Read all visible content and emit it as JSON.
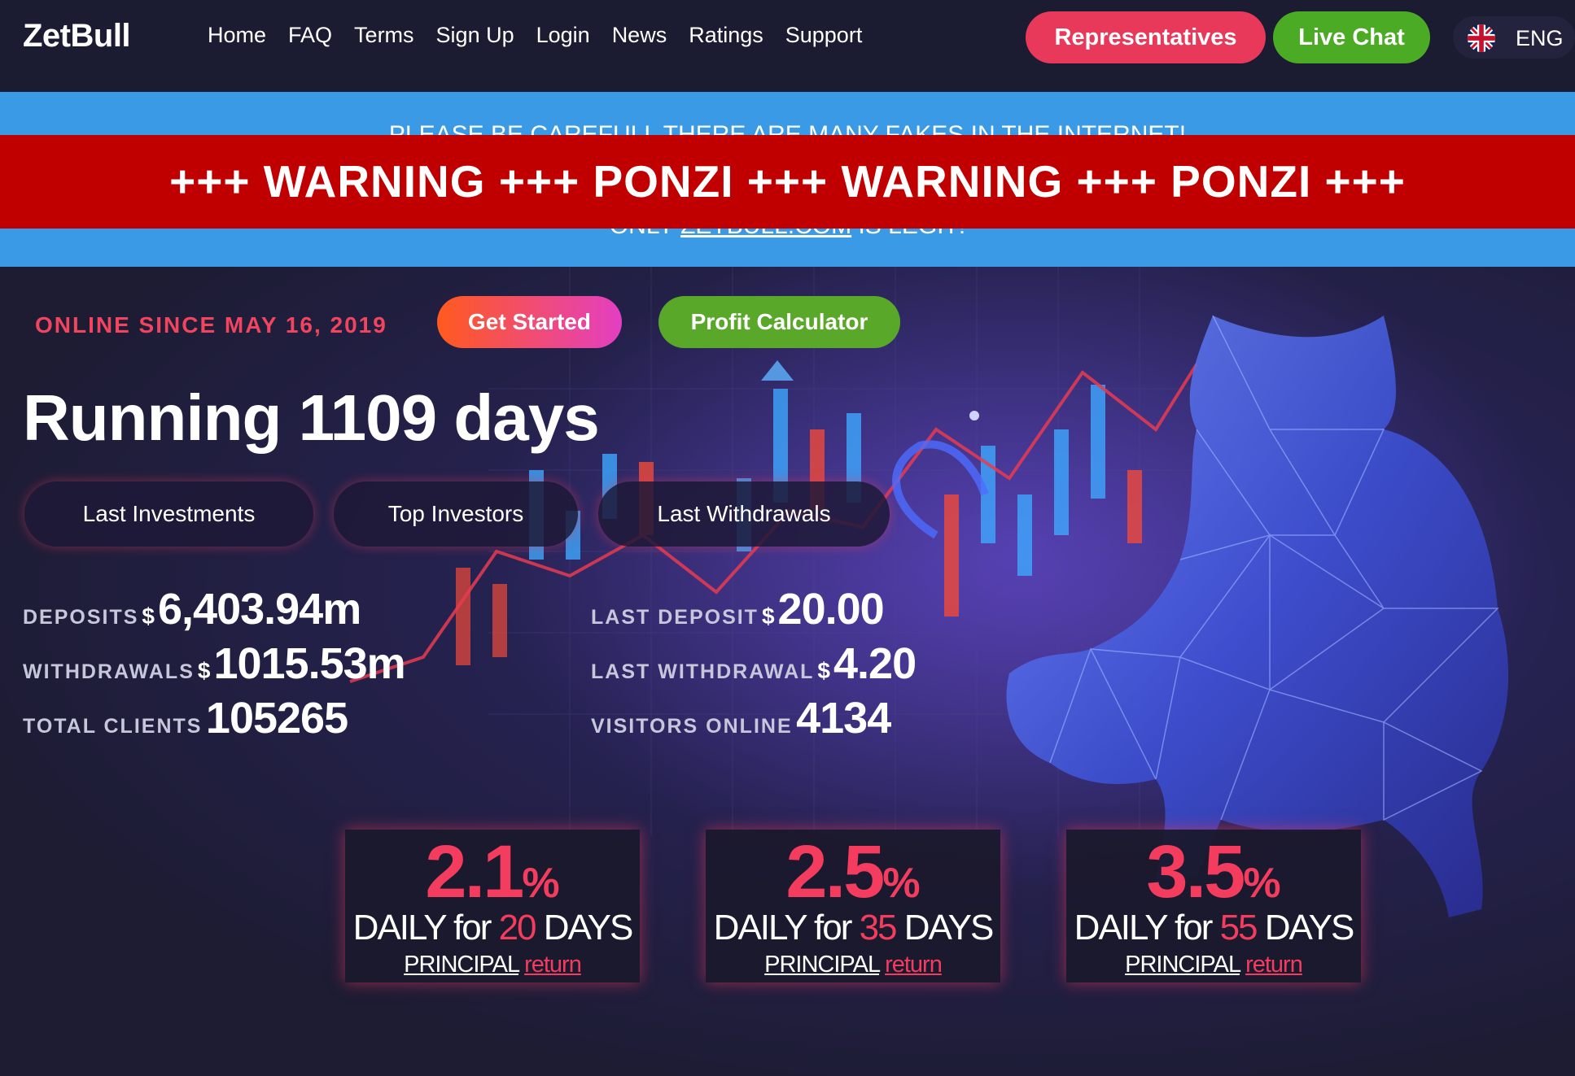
{
  "header": {
    "logo": "ZetBull",
    "nav": [
      "Home",
      "FAQ",
      "Terms",
      "Sign Up",
      "Login",
      "News",
      "Ratings",
      "Support"
    ],
    "representatives_label": "Representatives",
    "live_chat_label": "Live Chat",
    "language": "ENG"
  },
  "notice": {
    "line1": "PLEASE BE CAREFULL THERE ARE MANY FAKES IN THE INTERNET!",
    "line2_prefix": "ONLY ",
    "line2_link": "ZETBULL.COM",
    "line2_suffix": " IS LEGIT!"
  },
  "warning": "+++ WARNING +++ PONZI +++ WARNING +++ PONZI +++",
  "hero": {
    "online_since": "ONLINE SINCE MAY 16, 2019",
    "get_started_label": "Get Started",
    "profit_calculator_label": "Profit Calculator",
    "running": "Running 1109 days",
    "tabs": [
      "Last Investments",
      "Top Investors",
      "Last Withdrawals"
    ]
  },
  "stats": {
    "currency": "$",
    "deposits_label": "DEPOSITS",
    "deposits_value": "6,403.94m",
    "withdrawals_label": "WITHDRAWALS",
    "withdrawals_value": "1015.53m",
    "total_clients_label": "TOTAL CLIENTS",
    "total_clients_value": "105265",
    "last_deposit_label": "LAST DEPOSIT",
    "last_deposit_value": "20.00",
    "last_withdrawal_label": "LAST WITHDRAWAL",
    "last_withdrawal_value": "4.20",
    "visitors_online_label": "VISITORS ONLINE",
    "visitors_online_value": "4134"
  },
  "plans": [
    {
      "rate": "2.1",
      "symbol": "%",
      "daily": "DAILY for ",
      "days": "20",
      "days_word": " DAYS",
      "principal": "PRINCIPAL",
      "return": "return"
    },
    {
      "rate": "2.5",
      "symbol": "%",
      "daily": "DAILY for ",
      "days": "35",
      "days_word": " DAYS",
      "principal": "PRINCIPAL",
      "return": "return"
    },
    {
      "rate": "3.5",
      "symbol": "%",
      "daily": "DAILY for ",
      "days": "55",
      "days_word": " DAYS",
      "principal": "PRINCIPAL",
      "return": "return"
    }
  ],
  "colors": {
    "accent_red": "#f33c5e",
    "live_chat_green": "#4bab24",
    "notice_blue": "#3a9ae6",
    "warning_red": "#c00000"
  }
}
